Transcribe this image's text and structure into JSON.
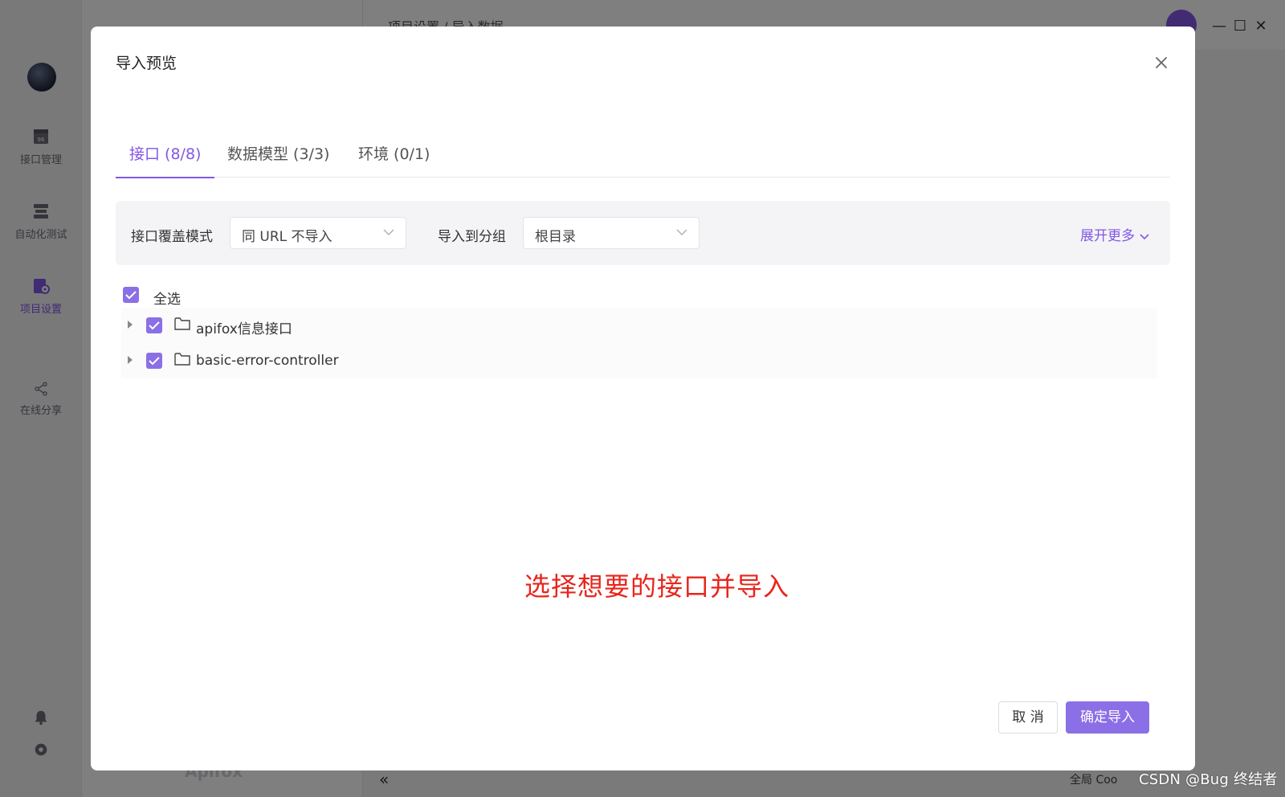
{
  "app": {
    "breadcrumb": "项目设置  /  导入数据",
    "sidebar": {
      "items": [
        {
          "label": "接口管理",
          "icon": "api-doc-icon"
        },
        {
          "label": "自动化测试",
          "icon": "automation-icon"
        },
        {
          "label": "项目设置",
          "icon": "project-settings-icon",
          "active": true
        },
        {
          "label": "在线分享",
          "icon": "share-icon"
        }
      ]
    },
    "brand": "Apifox",
    "status": "全局 Coo",
    "watermark": "CSDN @Bug 终结者"
  },
  "modal": {
    "title": "导入预览",
    "tabs": [
      {
        "label": "接口 (8/8)",
        "active": true
      },
      {
        "label": "数据模型 (3/3)",
        "active": false
      },
      {
        "label": "环境 (0/1)",
        "active": false
      }
    ],
    "filters": {
      "override_mode_label": "接口覆盖模式",
      "override_mode_value": "同 URL 不导入",
      "import_group_label": "导入到分组",
      "import_group_value": "根目录",
      "expand_more": "展开更多"
    },
    "tree": {
      "select_all": "全选",
      "items": [
        {
          "label": "apifox信息接口",
          "checked": true
        },
        {
          "label": "basic-error-controller",
          "checked": true
        }
      ]
    },
    "annotation": "选择想要的接口并导入",
    "buttons": {
      "cancel": "取 消",
      "confirm": "确定导入"
    }
  },
  "colors": {
    "accent": "#8257e5",
    "annotation": "#e8251c"
  }
}
